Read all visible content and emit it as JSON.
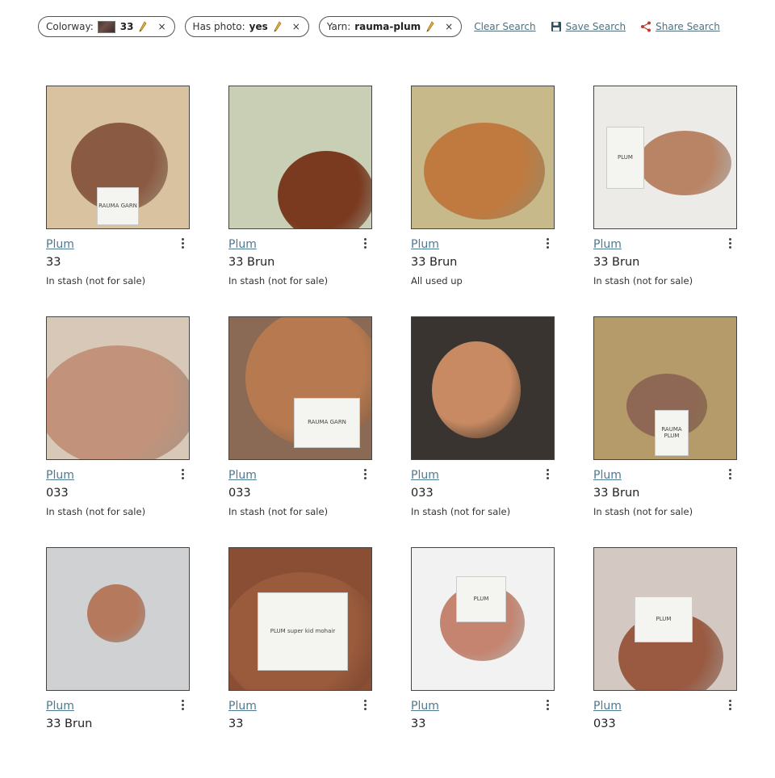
{
  "filters": [
    {
      "label": "Colorway:",
      "value": "33",
      "has_swatch": true,
      "remove": "×"
    },
    {
      "label": "Has photo:",
      "value": "yes",
      "has_swatch": false,
      "remove": "×"
    },
    {
      "label": "Yarn:",
      "value": "rauma-plum",
      "has_swatch": false,
      "remove": "×"
    }
  ],
  "actions": {
    "clear": "Clear Search",
    "save": "Save Search",
    "share": "Share Search"
  },
  "items": [
    {
      "yarn": "Plum",
      "colorway": "33",
      "status": "In stash (not for sale)",
      "photo": {
        "bg": "#d9c2a0",
        "ball": "#8a5a43",
        "tag_text": "RAUMA GARN"
      }
    },
    {
      "yarn": "Plum",
      "colorway": "33 Brun",
      "status": "In stash (not for sale)",
      "photo": {
        "bg": "#c9cfb5",
        "ball": "#7a3a20",
        "tag_text": ""
      }
    },
    {
      "yarn": "Plum",
      "colorway": "33 Brun",
      "status": "All used up",
      "photo": {
        "bg": "#c8b98a",
        "ball": "#c07a40",
        "tag_text": ""
      }
    },
    {
      "yarn": "Plum",
      "colorway": "33 Brun",
      "status": "In stash (not for sale)",
      "photo": {
        "bg": "#ecebe8",
        "ball": "#b98465",
        "tag_text": "PLUM"
      }
    },
    {
      "yarn": "Plum",
      "colorway": "033",
      "status": "In stash (not for sale)",
      "photo": {
        "bg": "#d8c8b8",
        "ball": "#c2937a",
        "tag_text": ""
      }
    },
    {
      "yarn": "Plum",
      "colorway": "033",
      "status": "In stash (not for sale)",
      "photo": {
        "bg": "#8b6a55",
        "ball": "#b77a50",
        "tag_text": "RAUMA GARN"
      }
    },
    {
      "yarn": "Plum",
      "colorway": "033",
      "status": "In stash (not for sale)",
      "photo": {
        "bg": "#3a3430",
        "ball": "#c78a62",
        "tag_text": ""
      }
    },
    {
      "yarn": "Plum",
      "colorway": "33 Brun",
      "status": "In stash (not for sale)",
      "photo": {
        "bg": "#b59a6a",
        "ball": "#8e6755",
        "tag_text": "RAUMA PLUM"
      }
    },
    {
      "yarn": "Plum",
      "colorway": "33 Brun",
      "status": "",
      "photo": {
        "bg": "#cfd1d2",
        "ball": "#b57a5e",
        "tag_text": ""
      }
    },
    {
      "yarn": "Plum",
      "colorway": "33",
      "status": "",
      "photo": {
        "bg": "#8a4e35",
        "ball": "#9a5a3c",
        "tag_text": "PLUM super kid mohair"
      }
    },
    {
      "yarn": "Plum",
      "colorway": "33",
      "status": "",
      "photo": {
        "bg": "#f2f2f2",
        "ball": "#c48470",
        "tag_text": "PLUM"
      }
    },
    {
      "yarn": "Plum",
      "colorway": "033",
      "status": "",
      "photo": {
        "bg": "#d3c9c2",
        "ball": "#9a5a42",
        "tag_text": "PLUM"
      }
    }
  ]
}
